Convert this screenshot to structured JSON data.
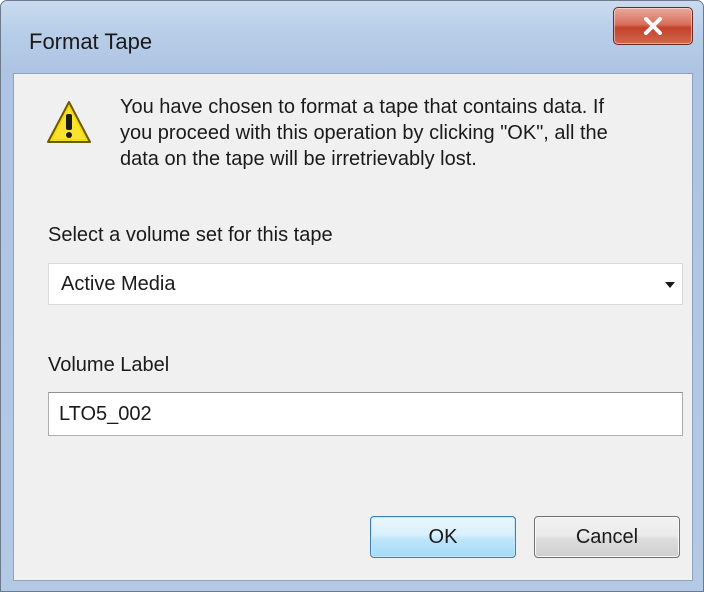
{
  "window": {
    "title": "Format Tape"
  },
  "icons": {
    "warning": "warning-icon",
    "close": "close-icon",
    "dropdown": "chevron-down-icon"
  },
  "message": {
    "lines": [
      "You have chosen to format a tape that contains data.  If",
      "you proceed with this operation by clicking \"OK\", all the",
      "data on the tape will be irretrievably lost."
    ]
  },
  "volume_set": {
    "label": "Select a volume set for this tape",
    "selected": "Active Media"
  },
  "volume_label": {
    "label": "Volume Label",
    "value": "LTO5_002"
  },
  "buttons": {
    "ok": "OK",
    "cancel": "Cancel"
  },
  "colors": {
    "close_button": "#c4412b",
    "default_button_border": "#3c7fb1",
    "warning_yellow": "#f5d90a"
  }
}
